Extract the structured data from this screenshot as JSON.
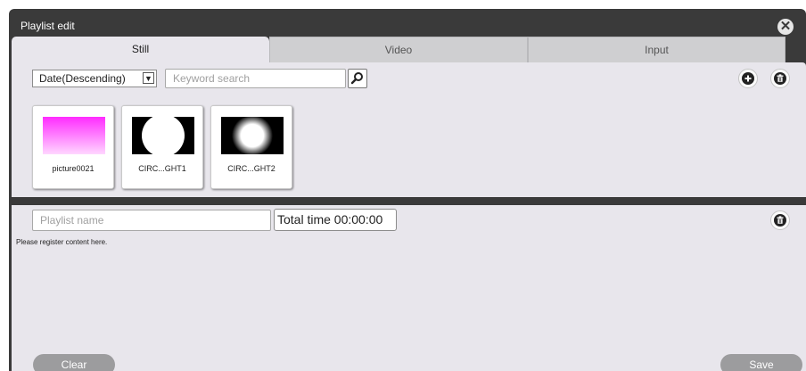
{
  "dialog": {
    "title": "Playlist edit"
  },
  "tabs": [
    {
      "label": "Still",
      "active": true
    },
    {
      "label": "Video",
      "active": false
    },
    {
      "label": "Input",
      "active": false
    }
  ],
  "library": {
    "sort": {
      "selected": "Date(Descending)"
    },
    "search": {
      "placeholder": "Keyword search"
    },
    "items": [
      {
        "label": "picture0021",
        "preview": "magenta-gradient"
      },
      {
        "label": "CIRC...GHT1",
        "preview": "white-circle-on-black"
      },
      {
        "label": "CIRC...GHT2",
        "preview": "soft-white-circle-on-black"
      }
    ]
  },
  "playlist": {
    "name": {
      "placeholder": "Playlist name"
    },
    "total_time": "Total time 00:00:00",
    "hint": "Please register content here.",
    "clear_label": "Clear",
    "save_label": "Save"
  },
  "icons": {
    "close": "close-icon",
    "search": "search-icon",
    "add": "plus-circle-icon",
    "delete": "trash-icon",
    "dropdown": "chevron-down-icon"
  },
  "colors": {
    "title_bar": "#3a3a3a",
    "panel": "#e8e6ec",
    "inactive_tab": "#cfcfd1",
    "button_gray": "#9c9c9e",
    "magenta_gradient_top": "#ff2bff",
    "magenta_gradient_bottom": "#ffd6ff"
  }
}
